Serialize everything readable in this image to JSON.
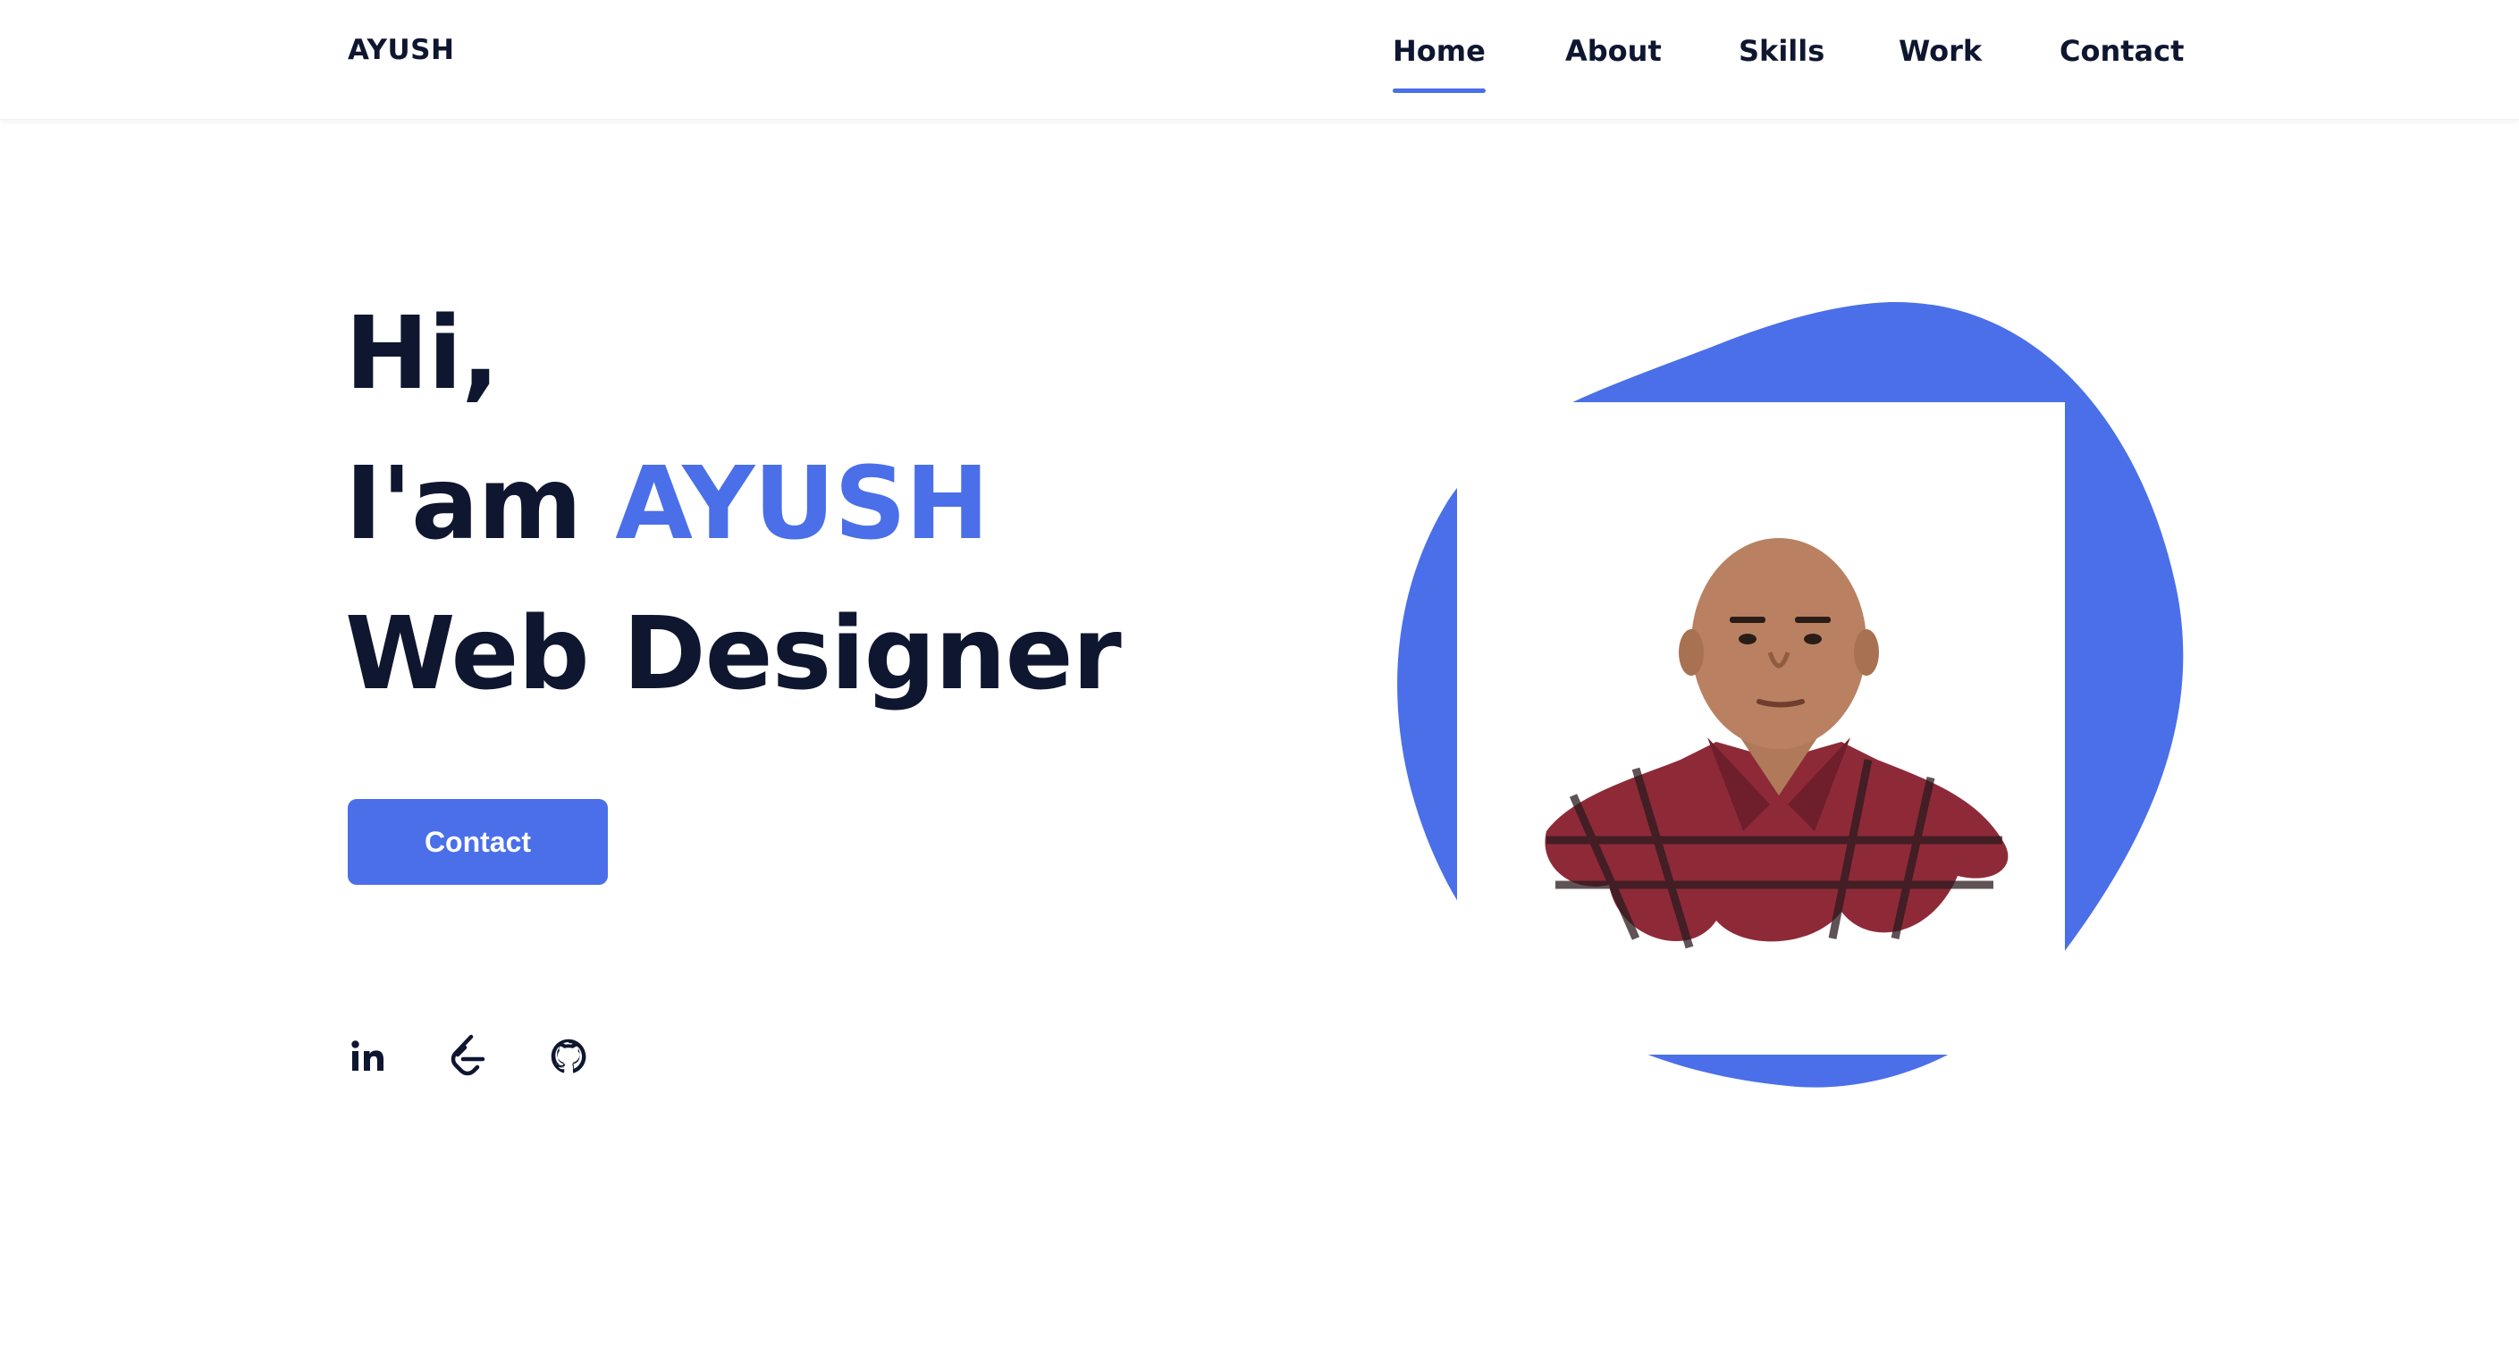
{
  "header": {
    "brand": "AYUSH",
    "nav": [
      {
        "label": "Home",
        "active": true
      },
      {
        "label": "About",
        "active": false
      },
      {
        "label": "Skills",
        "active": false
      },
      {
        "label": "Work",
        "active": false
      },
      {
        "label": "Contact",
        "active": false
      }
    ]
  },
  "hero": {
    "greeting": "Hi,",
    "intro_prefix": "I'am ",
    "name": "AYUSH",
    "role": "Web Designer",
    "cta_label": "Contact"
  },
  "social": [
    {
      "icon": "linkedin-icon"
    },
    {
      "icon": "leetcode-icon"
    },
    {
      "icon": "github-icon"
    }
  ],
  "colors": {
    "accent": "#4a6fe9",
    "text": "#0f1630",
    "background": "#ffffff"
  }
}
